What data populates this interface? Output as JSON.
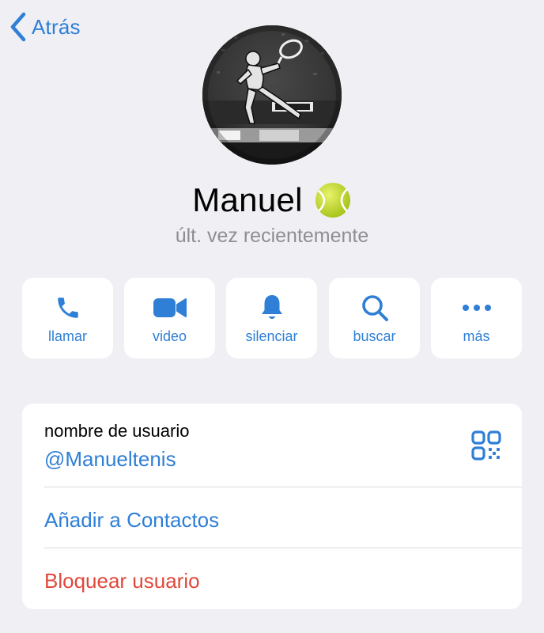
{
  "nav": {
    "back_label": "Atrás"
  },
  "profile": {
    "name": "Manuel",
    "emoji_icon": "tennis-ball-icon",
    "status": "últ. vez recientemente"
  },
  "actions": [
    {
      "label": "llamar",
      "icon": "phone-icon"
    },
    {
      "label": "video",
      "icon": "video-camera-icon"
    },
    {
      "label": "silenciar",
      "icon": "bell-icon"
    },
    {
      "label": "buscar",
      "icon": "search-icon"
    },
    {
      "label": "más",
      "icon": "more-icon"
    }
  ],
  "info": {
    "username_caption": "nombre de usuario",
    "username_value": "@Manueltenis",
    "add_contact_label": "Añadir a Contactos",
    "block_label": "Bloquear usuario"
  },
  "colors": {
    "accent": "#2f7fd6",
    "destructive": "#e0483b",
    "background": "#efeff4",
    "card": "#ffffff",
    "secondary_text": "#8e8e93"
  }
}
